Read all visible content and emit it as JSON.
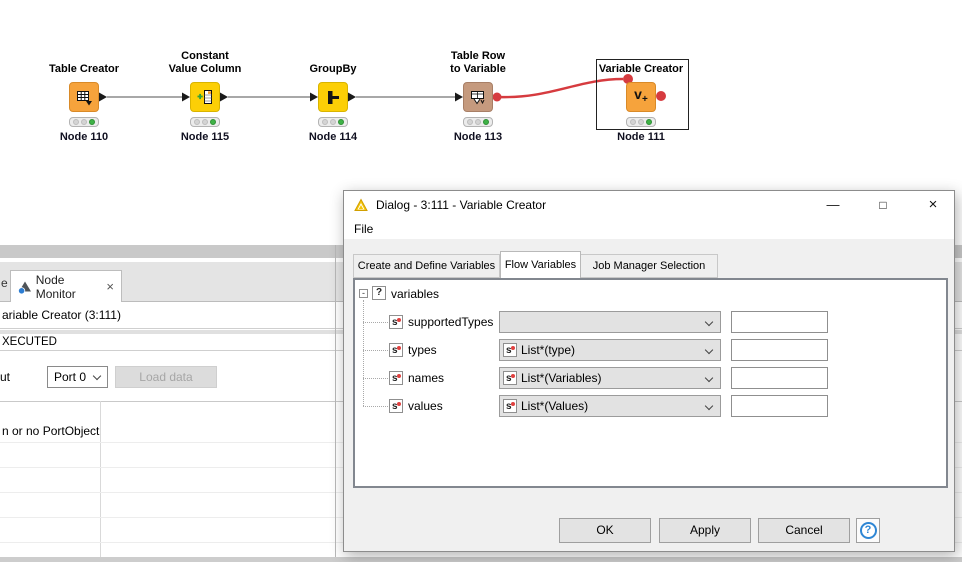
{
  "workflow": {
    "nodes": [
      {
        "name": "Table Creator",
        "name2": "",
        "id": "Node 110"
      },
      {
        "name": "Constant",
        "name2": "Value Column",
        "id": "Node 115"
      },
      {
        "name": "GroupBy",
        "name2": "",
        "id": "Node 114"
      },
      {
        "name": "Table Row",
        "name2": "to Variable",
        "id": "Node 113"
      },
      {
        "name": "Variable Creator",
        "name2": "",
        "id": "Node 111"
      }
    ],
    "variable_creator_glyph": {
      "v": "v",
      "plus": "+"
    }
  },
  "monitor": {
    "partial_tab": "e",
    "tab_label": "Node Monitor",
    "tab_close": "×",
    "node_ref": "ariable Creator  (3:111)",
    "status": "XECUTED",
    "output_label": "ut",
    "port_value": "Port 0",
    "load_data": "Load data",
    "message": "n or no PortObject"
  },
  "dialog": {
    "title": "Dialog - 3:111 - Variable Creator",
    "window_controls": {
      "minimize": "—",
      "maximize": "□",
      "close": "×"
    },
    "menu_file": "File",
    "tabs": [
      {
        "label": "Create and Define Variables"
      },
      {
        "label": "Flow Variables"
      },
      {
        "label": "Job Manager Selection"
      }
    ],
    "active_tab": "Flow Variables",
    "tree": {
      "expander_glyph": "-",
      "root_icon": "?",
      "root_label": "variables",
      "var_icon_letter": "s",
      "rows": [
        {
          "label": "supportedTypes",
          "combo_text": "",
          "field": ""
        },
        {
          "label": "types",
          "combo_text": "List*(type)",
          "field": ""
        },
        {
          "label": "names",
          "combo_text": "List*(Variables)",
          "field": ""
        },
        {
          "label": "values",
          "combo_text": "List*(Values)",
          "field": ""
        }
      ]
    },
    "buttons": {
      "ok": "OK",
      "apply": "Apply",
      "cancel": "Cancel",
      "help": "?"
    }
  },
  "colors": {
    "node_orange": "#f6a33c",
    "node_yellow": "#fccf06",
    "node_tan": "#c59a7e",
    "flow_variable_red": "#d63b3f",
    "led_green": "#3fb347",
    "connection_grey": "#8c8c8c",
    "help_blue": "#2e86d4"
  }
}
